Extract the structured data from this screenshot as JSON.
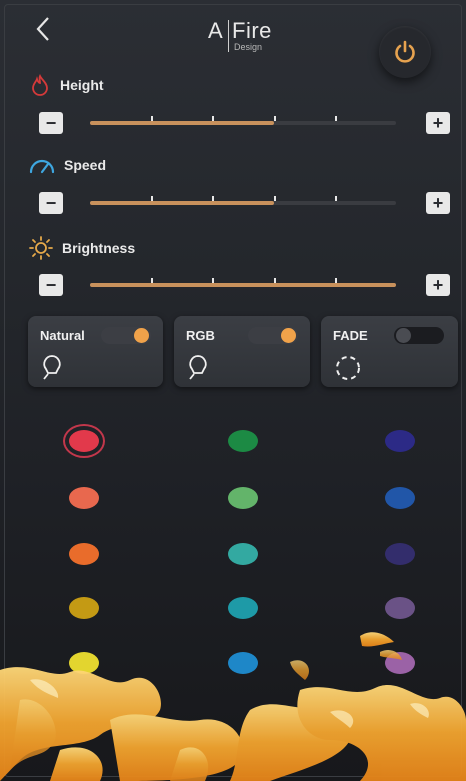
{
  "header": {
    "back_icon": "chevron-left-icon",
    "logo": {
      "a": "A",
      "fire": "Fire",
      "design": "Design"
    },
    "power_icon": "power-icon",
    "power_color": "#e6a24f"
  },
  "sliders": [
    {
      "label": "Height",
      "icon": "flame-icon",
      "icon_color": "#d43a3a",
      "value": 0.6
    },
    {
      "label": "Speed",
      "icon": "speedometer-icon",
      "icon_color": "#3ea7e0",
      "value": 0.6
    },
    {
      "label": "Brightness",
      "icon": "sun-icon",
      "icon_color": "#e6a94a",
      "value": 1.0
    }
  ],
  "buttons": {
    "minus": "−",
    "plus": "+"
  },
  "modes": [
    {
      "label": "Natural",
      "on": true,
      "icon": "bulb-icon"
    },
    {
      "label": "RGB",
      "on": true,
      "icon": "bulb-icon"
    },
    {
      "label": "FADE",
      "on": false,
      "icon": "dashed-circle-icon"
    }
  ],
  "accent": "#f0a24a",
  "color_columns": [
    [
      "#e2394b",
      "#e8684e",
      "#e96c2b",
      "#c49a14",
      "#e3d52f"
    ],
    [
      "#1c8a44",
      "#63b46a",
      "#33a9a1",
      "#1e9aa7",
      "#1e87c8"
    ],
    [
      "#2c2a86",
      "#2156a8",
      "#332d6c",
      "#6a5286",
      "#9b62a6"
    ]
  ],
  "selected_color_index": 0
}
